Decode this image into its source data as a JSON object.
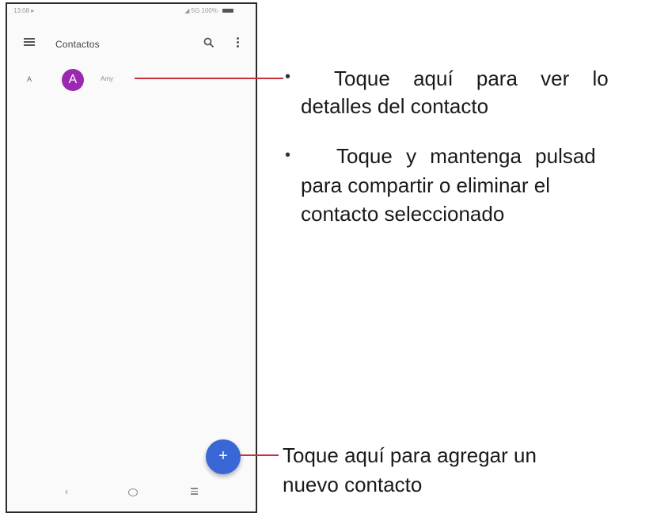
{
  "status_bar": {
    "time": "13:08 ▸",
    "indicators": "◢ 5G 100%"
  },
  "app_bar": {
    "menu_icon": "hamburger-menu",
    "title": "Contactos",
    "search_icon": "search",
    "more_icon": "vertical-ellipsis"
  },
  "contacts": {
    "section_letter": "A",
    "items": [
      {
        "initial": "A",
        "name": "Amy",
        "avatar_color": "#9c27b0"
      }
    ]
  },
  "fab": {
    "icon_text": "+",
    "color": "#3a67d6"
  },
  "nav_bar": {
    "back_icon": "‹",
    "home_icon": "circle",
    "recents_icon": "three-lines"
  },
  "callouts": {
    "contact_tap": {
      "line1": "Toque aquí para ver lo",
      "line2": "detalles del contacto"
    },
    "contact_hold": {
      "line1": "Toque y mantenga pulsad",
      "line2": "para compartir o eliminar el",
      "line3": "contacto seleccionado"
    },
    "add_contact": {
      "line1": "Toque aquí para agregar un",
      "line2": "nuevo contacto"
    },
    "bullet": "•",
    "line_color": "#c8323a"
  }
}
